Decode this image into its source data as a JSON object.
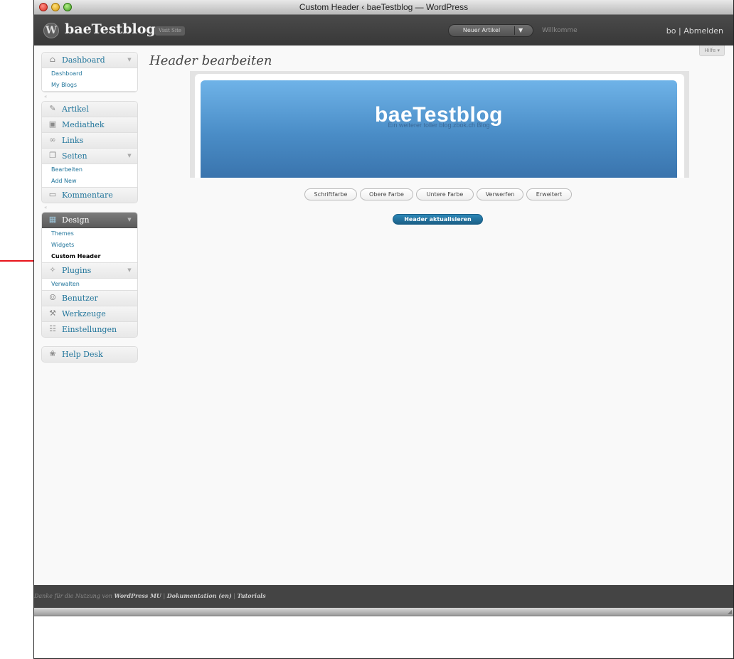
{
  "window": {
    "title": "Custom Header ‹ baeTestblog — WordPress"
  },
  "wphead": {
    "blog_name": "baeTestblog",
    "visit_site": "Visit Site",
    "new_post": "Neuer Artikel",
    "new_post_arrow": "▼",
    "welcome": "Willkomme",
    "user_fragment": "bo",
    "separator": "|",
    "logout": "Abmelden"
  },
  "help_tab": "Hilfe ▾",
  "page_title": "Header bearbeiten",
  "menu": {
    "dashboard": {
      "label": "Dashboard",
      "sub": [
        "Dashboard",
        "My Blogs"
      ]
    },
    "artikel": "Artikel",
    "mediathek": "Mediathek",
    "links": "Links",
    "seiten": {
      "label": "Seiten",
      "sub": [
        "Bearbeiten",
        "Add New"
      ]
    },
    "kommentare": "Kommentare",
    "design": {
      "label": "Design",
      "sub": [
        "Themes",
        "Widgets",
        "Custom Header"
      ]
    },
    "plugins": {
      "label": "Plugins",
      "sub": [
        "Verwalten"
      ]
    },
    "benutzer": "Benutzer",
    "werkzeuge": "Werkzeuge",
    "einstellungen": "Einstellungen",
    "help_desk": "Help Desk",
    "collapse_glyph": "«",
    "toggle_glyph": "▼"
  },
  "preview": {
    "blogname": "baeTestblog",
    "tagline": "Ein weiterer toller blog.zbok.ch Blog"
  },
  "buttons": {
    "text_color": "Schriftfarbe",
    "upper_color": "Obere Farbe",
    "lower_color": "Untere Farbe",
    "discard": "Verwerfen",
    "advanced": "Erweitert",
    "update_header": "Header aktualisieren"
  },
  "footer": {
    "prefix": "Danke für die Nutzung von",
    "wpmu": "WordPress MU",
    "sep": "|",
    "docs": "Dokumentation (en)",
    "tutorials": "Tutorials"
  },
  "colors": {
    "link": "#21759b",
    "header_dark": "#383838",
    "accent_blue": "#1b5f87",
    "arrow_red": "#e8141b"
  }
}
